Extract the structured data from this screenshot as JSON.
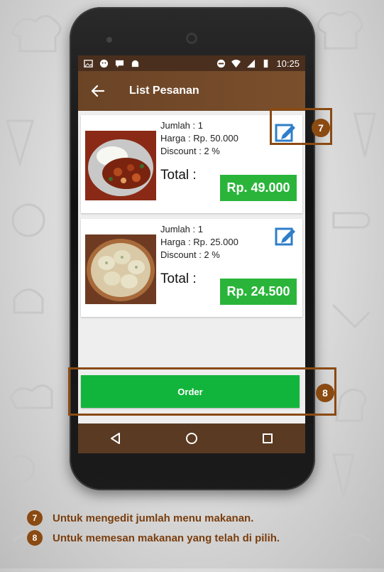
{
  "statusbar": {
    "time": "10:25"
  },
  "appbar": {
    "title": "List Pesanan"
  },
  "items": [
    {
      "jumlah": "Jumlah : 1",
      "harga": "Harga  : Rp. 50.000",
      "discount": "Discount : 2 %",
      "total_label": "Total :",
      "total_value": "Rp. 49.000",
      "image": "stir-fried-chicken-with-rice"
    },
    {
      "jumlah": "Jumlah : 1",
      "harga": "Harga  : Rp. 25.000",
      "discount": "Discount : 2 %",
      "total_label": "Total :",
      "total_value": "Rp. 24.500",
      "image": "steamed-dumplings"
    }
  ],
  "order_button": {
    "label": "Order"
  },
  "callouts": {
    "edit_number": "7",
    "order_number": "8"
  },
  "legend": [
    {
      "number": "7",
      "text": "Untuk mengedit jumlah menu makanan."
    },
    {
      "number": "8",
      "text": "Untuk  memesan makanan yang telah di pilih."
    }
  ],
  "colors": {
    "appbar": "#6b4426",
    "statusbar": "#4a2f1e",
    "price_green": "#2ab53a",
    "order_green": "#12b53b",
    "edit_blue": "#2f7ec9",
    "callout_brown": "#8a4a12",
    "navbar": "#5a3a22"
  }
}
